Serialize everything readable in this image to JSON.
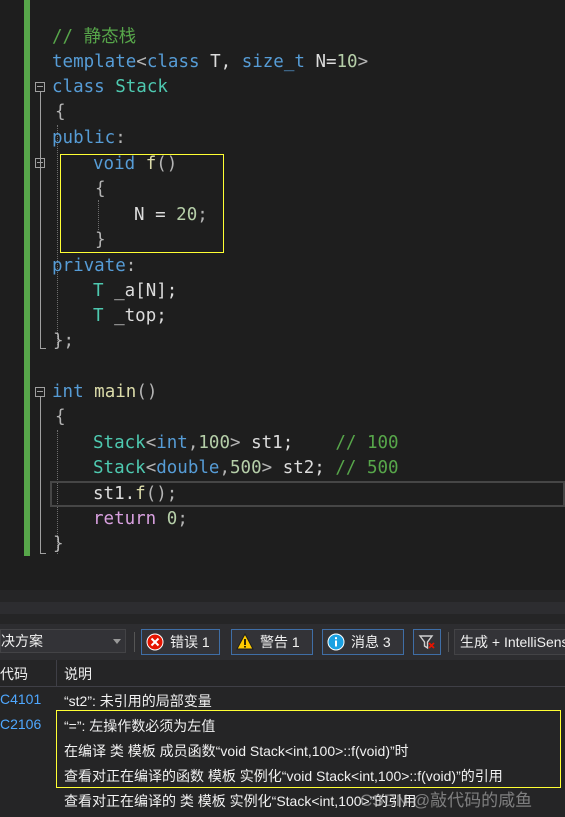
{
  "code": {
    "l01": "// 静态栈",
    "l02": [
      "template",
      "<",
      "class",
      " T, ",
      "size_t",
      " N=",
      "10",
      ">"
    ],
    "l03": [
      "class",
      " ",
      "Stack"
    ],
    "l04": "{",
    "l05": [
      "public",
      ":"
    ],
    "l06": [
      "void",
      " ",
      "f",
      "()"
    ],
    "l07": "{",
    "l08": [
      "N = ",
      "20",
      ";"
    ],
    "l09": "}",
    "l10": [
      "private",
      ":"
    ],
    "l11": [
      "T",
      " _a[N];"
    ],
    "l12": [
      "T",
      " _top;"
    ],
    "l13": "};",
    "l14": [
      "int",
      " ",
      "main",
      "()"
    ],
    "l15": "{",
    "l16": [
      "Stack",
      "<",
      "int",
      ",",
      "100",
      ">",
      " st1;    ",
      "// 100"
    ],
    "l17": [
      "Stack",
      "<",
      "double",
      ",",
      "500",
      ">",
      " st2; ",
      "// 500"
    ],
    "l18": [
      "st1.",
      "f",
      "();"
    ],
    "l19": [
      "return",
      " ",
      "0",
      ";"
    ],
    "l20": "}"
  },
  "toolbar": {
    "scope_label": "决方案",
    "errors_label": "错误 1",
    "warnings_label": "警告 1",
    "messages_label": "消息 3",
    "build_label": "生成 + IntelliSense"
  },
  "list": {
    "col_code": "代码",
    "col_desc": "说明",
    "rows": [
      {
        "code": "C4101",
        "desc": "“st2”: 未引用的局部变量"
      },
      {
        "code": "C2106",
        "desc": "“=”: 左操作数必须为左值"
      },
      {
        "code": "",
        "desc": "在编译 类 模板 成员函数“void Stack<int,100>::f(void)”时"
      },
      {
        "code": "",
        "desc": "查看对正在编译的函数 模板 实例化“void Stack<int,100>::f(void)”的引用"
      },
      {
        "code": "",
        "desc": "查看对正在编译的 类 模板 实例化“Stack<int,100>”的引用"
      }
    ]
  },
  "watermark": "CSDN @敲代码的咸鱼",
  "colors": {
    "keyword": "#569cd6",
    "type": "#4ec9b0",
    "comment": "#57a64a",
    "number": "#b5cea8",
    "function": "#dcdcaa",
    "highlight_box": "#ffff33"
  }
}
